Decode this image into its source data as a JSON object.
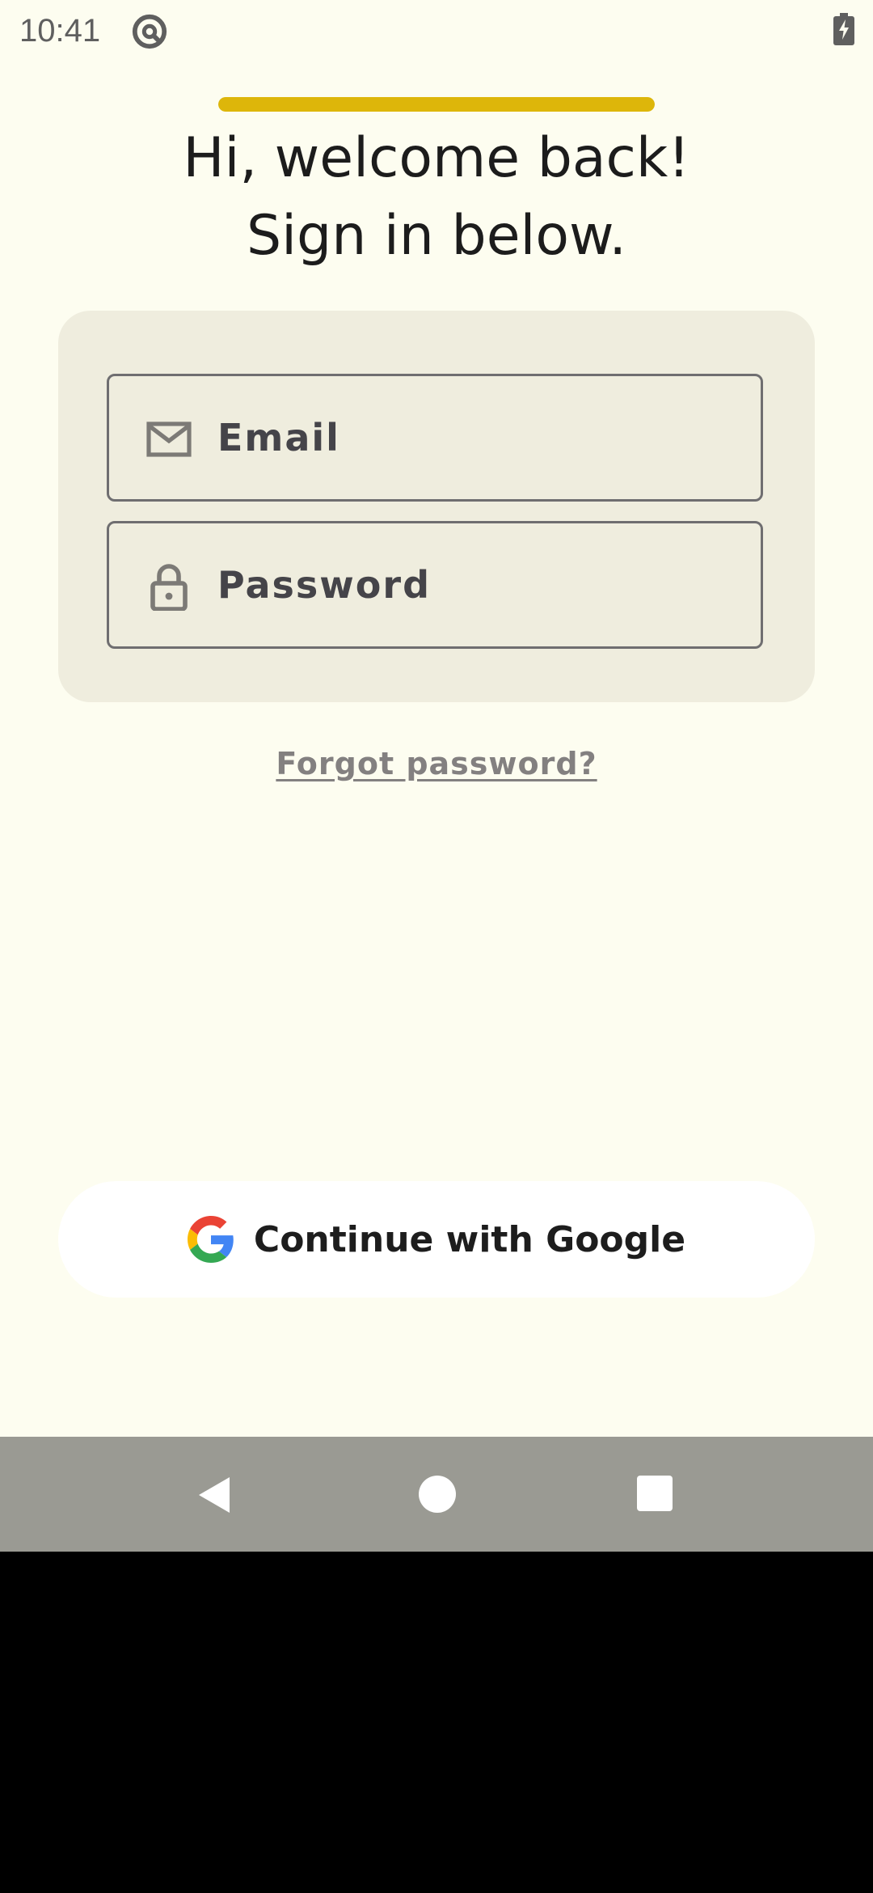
{
  "status_bar": {
    "time": "10:41",
    "icons": [
      "at-sign-icon",
      "battery-charging-icon"
    ]
  },
  "onboarding": {
    "progress_fraction": 1.0,
    "progress_color": "#DDB60A"
  },
  "heading": {
    "line1": "Hi, welcome back!",
    "line2": "Sign in below."
  },
  "form": {
    "email_placeholder": "Email",
    "email_icon": "mail-icon",
    "password_placeholder": "Password",
    "password_icon": "lock-icon"
  },
  "links": {
    "forgot_password": "Forgot password?"
  },
  "google_button": {
    "label": "Continue with Google",
    "icon": "google-logo-icon"
  },
  "nav_bar": {
    "icons": [
      "back-icon",
      "home-icon",
      "recents-icon"
    ]
  },
  "colors": {
    "background": "#FDFDF0",
    "card": "#EFEDDE",
    "accent": "#DDB60A",
    "nav_bar": "#9A9A93"
  }
}
